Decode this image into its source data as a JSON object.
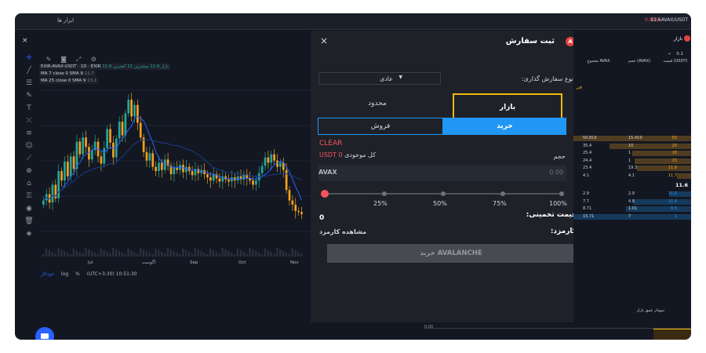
{
  "topbar": {
    "tools_label": "ابزار ها",
    "change_pct": "0.85%",
    "pair_label": "11.6AVAX/USDT"
  },
  "chart": {
    "symbol_line": "EXIR:AVAX-USDT · 1D · EXIR",
    "ohlc_line": "بازار 11.6 بیشترین 11 کمترین 11.6",
    "ma1_label": "MA 7 close 0 SMA 9",
    "ma1_value": "11.7",
    "ma2_label": "MA 25 close 0 SMA 9",
    "ma2_value": "13.1",
    "x_labels": [
      "Jul",
      "آگوست",
      "Sep",
      "Oct",
      "Nov"
    ],
    "bottom": {
      "auto": "خودکار",
      "log": "log",
      "percent": "%",
      "time": "(UTC+3:30) 10:51:30"
    },
    "tradingview_mark": "TV",
    "colors": {
      "up": "#26a69a",
      "down": "#f0a020",
      "ma_fast": "#2962ff",
      "ma_slow": "#1e3a8a"
    }
  },
  "chart_data": {
    "type": "candlestick",
    "x_labels": [
      "Jul",
      "آگوست",
      "Sep",
      "Oct",
      "Nov"
    ],
    "series": [
      {
        "name": "AVAX-USDT",
        "close": [
          13.0,
          13.6,
          12.8,
          14.5,
          13.2,
          15.8,
          14.9,
          16.7,
          15.3,
          17.2,
          16.0,
          18.6,
          17.4,
          19.0,
          18.1,
          16.9,
          17.8,
          18.6,
          17.2,
          16.5,
          18.0,
          19.8,
          18.5,
          17.1,
          18.9,
          20.5,
          19.2,
          21.3,
          22.6,
          21.0,
          22.1,
          20.4,
          19.0,
          17.6,
          16.8,
          17.5,
          16.2,
          15.8,
          16.6,
          15.9,
          16.9,
          16.3,
          15.5,
          16.1,
          15.9,
          16.4,
          15.7,
          16.2,
          15.8,
          15.4,
          16.0,
          15.6,
          15.9,
          15.5,
          15.2,
          14.9,
          15.5,
          15.1,
          14.8,
          15.3,
          15.0,
          14.8,
          15.2,
          14.9,
          15.3,
          15.0,
          15.5,
          15.1,
          14.9,
          14.5,
          14.9,
          15.6,
          16.3,
          17.1,
          16.6,
          17.4,
          16.8,
          16.2,
          16.6,
          15.9,
          14.0,
          13.0,
          12.6,
          12.0,
          11.9,
          11.7
        ]
      }
    ]
  },
  "modal": {
    "title": "ثبت سفارش",
    "close_glyph": "×",
    "logo_glyph": "A",
    "order_type_label": "نوع سفارش گذاری:",
    "order_type_value": "عادی",
    "tab_market": "بازار",
    "tab_limit": "محدود",
    "side_sell": "فروش",
    "side_buy": "خرید",
    "clear": "CLEAR",
    "volume_label": "حجم",
    "balance_label": "کل موجودی",
    "balance_value": "USDT 0",
    "amount_currency": "AVAX",
    "amount_value": "0.00",
    "slider_value": 0,
    "slider_marks": [
      "25%",
      "50%",
      "75%",
      "100%"
    ],
    "estimate_label": "قیمت تخمینی:",
    "estimate_value": "0",
    "fee_label": "کارمزد:",
    "fee_link": "مشاهده کارمزد",
    "submit_label": "خرید AVALANCHE",
    "colors": {
      "accent": "#2196f3",
      "highlight": "#f0b90b",
      "sell": "#f7525f"
    }
  },
  "orderbook": {
    "title": "بازار",
    "precision": "0.1",
    "precision_btn": "+",
    "header": {
      "total": "مجموع AVAX",
      "amount": "حجم (AVAX)",
      "price": "قیمت (USDT)"
    },
    "side_letter": "فی",
    "asks": [
      {
        "total": "50.819",
        "amount": "15.419",
        "price": "50"
      },
      {
        "total": "35.4",
        "amount": "10",
        "price": "20"
      },
      {
        "total": "25.4",
        "amount": "1",
        "price": "18"
      },
      {
        "total": "24.4",
        "amount": "1",
        "price": "15"
      },
      {
        "total": "23.4",
        "amount": "19.3",
        "price": "11.9"
      },
      {
        "total": "4.1",
        "amount": "4.1",
        "price": "11.7"
      }
    ],
    "mid_price": "11.6",
    "bids": [
      {
        "total": "2.9",
        "amount": "2.9",
        "price": "11.6"
      },
      {
        "total": "7.7",
        "amount": "4.8",
        "price": "11.4"
      },
      {
        "total": "8.71",
        "amount": "1.01",
        "price": "8.5"
      },
      {
        "total": "15.71",
        "amount": "7",
        "price": "1"
      }
    ],
    "depth_title": "نمودار عمق بازار",
    "depth_tick": "0.00"
  }
}
